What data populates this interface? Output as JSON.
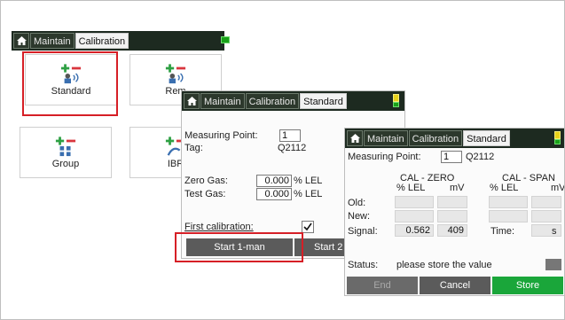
{
  "menu": {
    "tabs": [
      "Maintain",
      "Calibration"
    ],
    "tiles": [
      "Standard",
      "Remote",
      "Group",
      "IBR"
    ],
    "tile_visible": [
      "Standard",
      "Rem",
      "Group",
      "IBR"
    ]
  },
  "panel2": {
    "tabs": [
      "Maintain",
      "Calibration",
      "Standard"
    ],
    "measuring_point_label": "Measuring Point:",
    "measuring_point_value": "1",
    "tag_label": "Tag:",
    "tag_value": "Q2112",
    "zero_gas_label": "Zero Gas:",
    "zero_gas_value": "0.000",
    "zero_gas_unit": "% LEL",
    "test_gas_label": "Test Gas:",
    "test_gas_value": "0.000",
    "test_gas_unit": "% LEL",
    "first_cal_label": "First calibration:",
    "first_cal_checked": true,
    "start_1man_label": "Start 1-man",
    "start_2_label": "Start 2"
  },
  "panel3": {
    "tabs": [
      "Maintain",
      "Calibration",
      "Standard"
    ],
    "measuring_point_label": "Measuring Point:",
    "measuring_point_value": "1",
    "tag_value": "Q2112",
    "cal_zero_title": "CAL - ZERO",
    "cal_span_title": "CAL - SPAN",
    "col_lel": "% LEL",
    "col_mv": "mV",
    "row_old": "Old:",
    "row_new": "New:",
    "row_signal": "Signal:",
    "signal_lel": "0.562",
    "signal_mv": "409",
    "time_label": "Time:",
    "time_unit": "s",
    "status_label": "Status:",
    "status_text": "please store the value",
    "btn_end": "End",
    "btn_cancel": "Cancel",
    "btn_store": "Store"
  },
  "colors": {
    "highlight": "#d61f26",
    "tabbar": "#1d2a20",
    "battery_green": "#19a119",
    "battery_yellow": "#e8d21a",
    "store_green": "#1aa63a"
  }
}
